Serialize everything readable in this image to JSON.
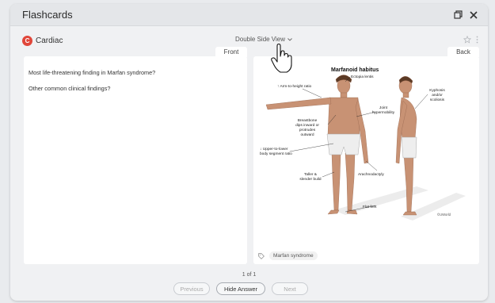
{
  "window": {
    "title": "Flashcards"
  },
  "toolbar": {
    "deck_initial": "C",
    "deck_name": "Cardiac",
    "view_mode": "Double Side View"
  },
  "front": {
    "tab": "Front",
    "lines": [
      "Most life-threatening finding in Marfan syndrome?",
      "Other common clinical findings?"
    ]
  },
  "back": {
    "tab": "Back",
    "figure": {
      "title": "Marfanoid habitus",
      "labels": {
        "ectopia": "Ectopia lentis",
        "arm": "↑ Arm-to-height ratio",
        "joint": "Joint hypermobility",
        "kyphosis": "Kyphosis and/or scoliosis",
        "breastbone": "Breastbone dips inward or protrudes outward",
        "segment": "↓ Upper-to-lower body segment ratio",
        "taller": "Taller & slender build",
        "arachno": "Arachnodactyly",
        "flatfeet": "Flat feet",
        "copyright": "©UWorld"
      }
    },
    "tag": "Marfan syndrome"
  },
  "pager": {
    "text": "1 of 1"
  },
  "nav": {
    "previous": "Previous",
    "hide_answer": "Hide Answer",
    "next": "Next"
  },
  "colors": {
    "accent": "#e0463a",
    "background": "#f0f1f3"
  }
}
